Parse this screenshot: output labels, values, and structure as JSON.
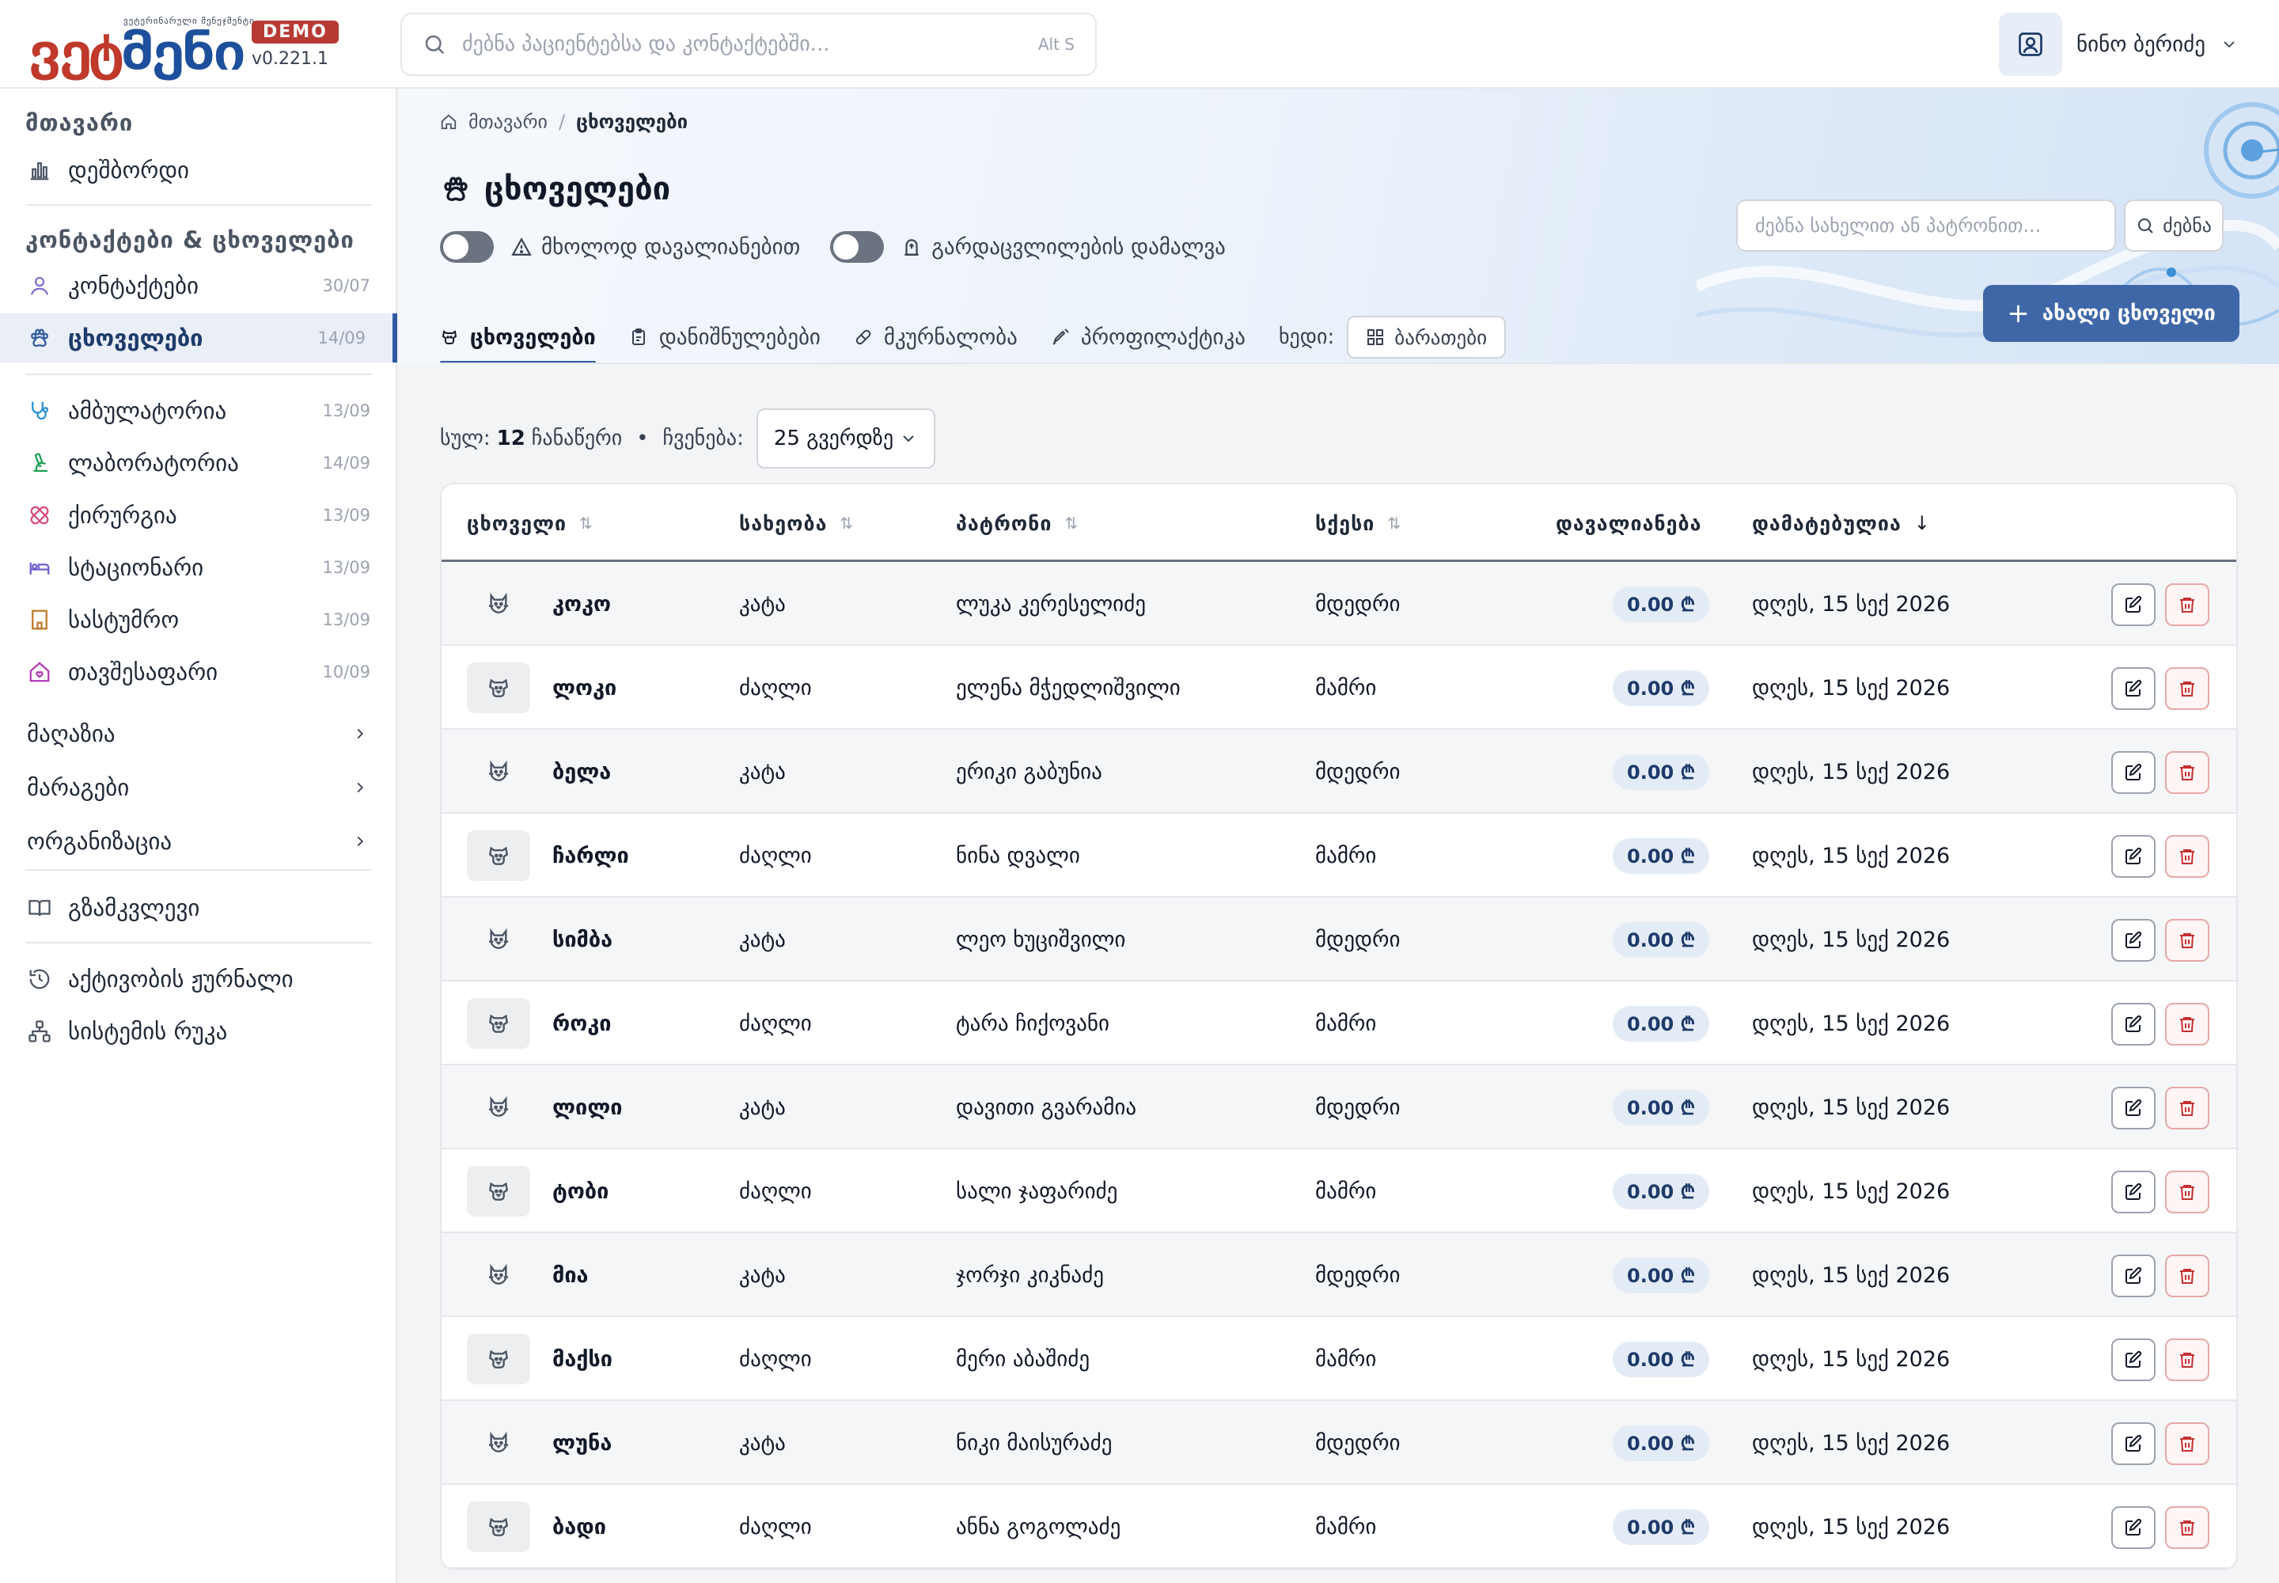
{
  "app": {
    "logo_tagline": "ვეტერინარული მენეჯმენტი",
    "logo_part1": "ვეტ",
    "logo_part2": "მენი",
    "badge": "DEMO",
    "version": "v0.221.1"
  },
  "topbar": {
    "search_placeholder": "ძებნა პაციენტებსა და კონტაქტებში...",
    "search_shortcut": "Alt S",
    "user_name": "ნინო ბერიძე"
  },
  "sidebar": {
    "section_main": "მთავარი",
    "dashboard": "დეშბორდი",
    "section_contacts": "კონტაქტები & ცხოველები",
    "items": [
      {
        "label": "კონტაქტები",
        "date": "30/07"
      },
      {
        "label": "ცხოველები",
        "date": "14/09"
      },
      {
        "label": "ამბულატორია",
        "date": "13/09"
      },
      {
        "label": "ლაბორატორია",
        "date": "14/09"
      },
      {
        "label": "ქირურგია",
        "date": "13/09"
      },
      {
        "label": "სტაციონარი",
        "date": "13/09"
      },
      {
        "label": "სასტუმრო",
        "date": "13/09"
      },
      {
        "label": "თავშესაფარი",
        "date": "10/09"
      }
    ],
    "groups": [
      "მაღაზია",
      "მარაგები",
      "ორგანიზაცია"
    ],
    "guide": "გზამკვლევი",
    "activity_log": "აქტივობის ჟურნალი",
    "system_map": "სისტემის რუკა"
  },
  "breadcrumb": {
    "home": "მთავარი",
    "current": "ცხოველები"
  },
  "page": {
    "title": "ცხოველები",
    "toggle_debt": "მხოლოდ დავალიანებით",
    "toggle_deceased": "გარდაცვლილების დამალვა",
    "search_placeholder": "ძებნა სახელით ან პატრონით...",
    "search_button": "ძებნა",
    "new_button": "ახალი ცხოველი"
  },
  "tabs": [
    {
      "label": "ცხოველები"
    },
    {
      "label": "დანიშნულებები"
    },
    {
      "label": "მკურნალობა"
    },
    {
      "label": "პროფილაქტიკა"
    }
  ],
  "view": {
    "label": "ხედი:",
    "button": "ბარათები"
  },
  "summary": {
    "total_label": "სულ:",
    "total_count": "12",
    "total_suffix": "ჩანაწერი",
    "show_label": "ჩვენება:",
    "per_page": "25 გვერდზე"
  },
  "table": {
    "headers": {
      "animal": "ცხოველი",
      "species": "სახეობა",
      "owner": "პატრონი",
      "sex": "სქესი",
      "debt": "დავალიანება",
      "added": "დამატებულია"
    },
    "rows": [
      {
        "name": "კოკო",
        "species": "კატა",
        "owner": "ლუკა კერესელიძე",
        "sex": "მდედრი",
        "debt": "0.00 ₾",
        "added": "დღეს, 15 სექ 2026",
        "kind": "cat"
      },
      {
        "name": "ლოკი",
        "species": "ძაღლი",
        "owner": "ელენა მჭედლიშვილი",
        "sex": "მამრი",
        "debt": "0.00 ₾",
        "added": "დღეს, 15 სექ 2026",
        "kind": "dog"
      },
      {
        "name": "ბელა",
        "species": "კატა",
        "owner": "ერიკი გაბუნია",
        "sex": "მდედრი",
        "debt": "0.00 ₾",
        "added": "დღეს, 15 სექ 2026",
        "kind": "cat"
      },
      {
        "name": "ჩარლი",
        "species": "ძაღლი",
        "owner": "ნინა დვალი",
        "sex": "მამრი",
        "debt": "0.00 ₾",
        "added": "დღეს, 15 სექ 2026",
        "kind": "dog"
      },
      {
        "name": "სიმბა",
        "species": "კატა",
        "owner": "ლეო ხუციშვილი",
        "sex": "მდედრი",
        "debt": "0.00 ₾",
        "added": "დღეს, 15 სექ 2026",
        "kind": "cat"
      },
      {
        "name": "როკი",
        "species": "ძაღლი",
        "owner": "ტარა ჩიქოვანი",
        "sex": "მამრი",
        "debt": "0.00 ₾",
        "added": "დღეს, 15 სექ 2026",
        "kind": "dog"
      },
      {
        "name": "ლილი",
        "species": "კატა",
        "owner": "დავითი გვარამია",
        "sex": "მდედრი",
        "debt": "0.00 ₾",
        "added": "დღეს, 15 სექ 2026",
        "kind": "cat"
      },
      {
        "name": "ტობი",
        "species": "ძაღლი",
        "owner": "სალი ჯაფარიძე",
        "sex": "მამრი",
        "debt": "0.00 ₾",
        "added": "დღეს, 15 სექ 2026",
        "kind": "dog"
      },
      {
        "name": "მია",
        "species": "კატა",
        "owner": "ჯორჯი კიკნაძე",
        "sex": "მდედრი",
        "debt": "0.00 ₾",
        "added": "დღეს, 15 სექ 2026",
        "kind": "cat"
      },
      {
        "name": "მაქსი",
        "species": "ძაღლი",
        "owner": "მერი აბაშიძე",
        "sex": "მამრი",
        "debt": "0.00 ₾",
        "added": "დღეს, 15 სექ 2026",
        "kind": "dog"
      },
      {
        "name": "ლუნა",
        "species": "კატა",
        "owner": "ნიკი მაისურაძე",
        "sex": "მდედრი",
        "debt": "0.00 ₾",
        "added": "დღეს, 15 სექ 2026",
        "kind": "cat"
      },
      {
        "name": "ბადი",
        "species": "ძაღლი",
        "owner": "ანნა გოგოლაძე",
        "sex": "მამრი",
        "debt": "0.00 ₾",
        "added": "დღეს, 15 სექ 2026",
        "kind": "dog"
      }
    ]
  },
  "colors": {
    "accent": "#2f5aa0",
    "primary_button": "#3f67a8",
    "logo_red": "#c0392b",
    "logo_blue": "#1e4f9c",
    "demo_badge": "#b83a34",
    "delete": "#c53030"
  }
}
